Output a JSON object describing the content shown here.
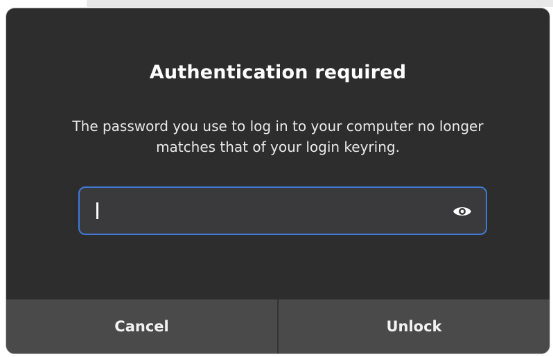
{
  "dialog": {
    "title": "Authentication required",
    "message": "The password you use to log in to your computer no longer matches that of your login keyring.",
    "password_field": {
      "value": "",
      "placeholder": "",
      "reveal_icon": "eye-icon"
    },
    "buttons": {
      "cancel_label": "Cancel",
      "unlock_label": "Unlock"
    }
  },
  "colors": {
    "dialog_bg": "#2d2d2d",
    "field_bg": "#3a3a3c",
    "focus_accent": "#3f7ad6",
    "button_bg": "#4a4a4a",
    "text": "#ffffff"
  }
}
